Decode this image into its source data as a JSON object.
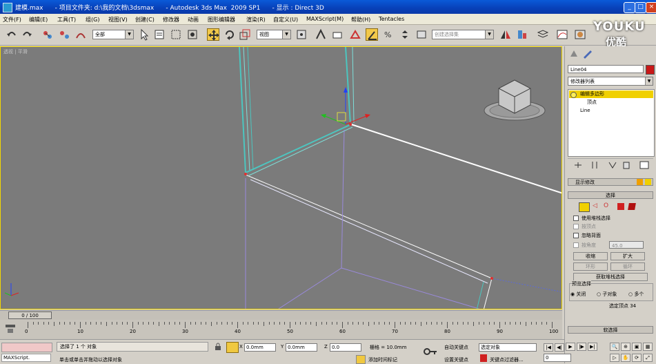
{
  "window": {
    "title": "建模.max      - 项目文件夹: d:\\我的文档\\3dsmax      - Autodesk 3ds Max  2009 SP1      - 显示 : Direct 3D"
  },
  "menu": [
    "文件(F)",
    "编辑(E)",
    "工具(T)",
    "组(G)",
    "视图(V)",
    "创建(C)",
    "修改器",
    "动画",
    "图形编辑器",
    "渲染(R)",
    "自定义(U)",
    "MAXScript(M)",
    "帮助(H)",
    "Tentacles"
  ],
  "toolbar": {
    "selection_filter": "全部",
    "ref_coord": "视图",
    "named_selection": "创建选择集"
  },
  "viewport": {
    "label": "透视 | 平滑"
  },
  "watermark": {
    "brand": "YOUKU",
    "brand_cn": "优酷"
  },
  "panel": {
    "object_name": "Line04",
    "modifier_list": "修改器列表",
    "stack": [
      "编辑多边形",
      "顶点",
      "Line"
    ],
    "rollout_select": "选择",
    "use_stack_select": "使用堆栈选择",
    "by_vertex": "按顶点",
    "ignore_backfacing": "忽略背面",
    "by_angle": "按角度",
    "angle_value": "45.0",
    "shrink": "收缩",
    "grow": "扩大",
    "ring": "环形",
    "loop": "循环",
    "get_stack_selection": "获取堆栈选择",
    "preview_selection": "预览选择",
    "preview_off": "关闭",
    "preview_subobj": "子对象",
    "preview_multi": "多个",
    "selected_vertices": "选定顶点 34",
    "soft_select": "软选择",
    "top_rollout": "显示修改"
  },
  "timeline": {
    "frame_display": "0 / 100",
    "ticks": [
      "0",
      "10",
      "20",
      "30",
      "40",
      "50",
      "60",
      "70",
      "80",
      "90",
      "100"
    ]
  },
  "status": {
    "script_label": "MAXScript.",
    "selected": "选择了 1 个 对象",
    "prompt": "单击或单击并拖动以选择对象",
    "x_value": "0.0mm",
    "y_value": "0.0mm",
    "z_value": "0.0",
    "grid": "栅格 = 10.0mm",
    "add_time_tag": "添加时间标记",
    "auto_key": "自动关键点",
    "set_key": "设置关键点",
    "selected_obj": "选定对象",
    "key_filters": "关键点过滤器...",
    "frame_value": "0"
  },
  "colors": {
    "viewport_bg": "#7b7b7b",
    "active_border": "#f3d800",
    "selected_row": "#f0d000"
  }
}
